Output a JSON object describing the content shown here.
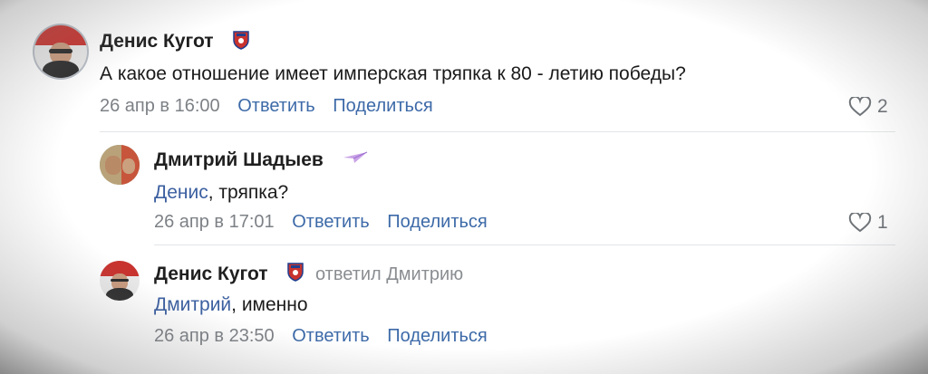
{
  "comments": [
    {
      "author": "Денис Кугот",
      "text": "А какое отношение имеет имперская тряпка к 80 - летию победы?",
      "date": "26 апр в 16:00",
      "reply_label": "Ответить",
      "share_label": "Поделиться",
      "likes": "2"
    },
    {
      "author": "Дмитрий Шадыев",
      "mention": "Денис",
      "text": ", тряпка?",
      "date": "26 апр в 17:01",
      "reply_label": "Ответить",
      "share_label": "Поделиться",
      "likes": "1"
    },
    {
      "author": "Денис Кугот",
      "reply_to": "ответил Дмитрию",
      "mention": "Дмитрий",
      "text": ", именно",
      "date": "26 апр в 23:50",
      "reply_label": "Ответить",
      "share_label": "Поделиться"
    }
  ],
  "icons": {
    "badge": "cska-badge-icon",
    "plane": "paper-plane-icon",
    "like": "heart-icon"
  },
  "colors": {
    "link": "#3d6aa8",
    "mention": "#3b5fa0",
    "badge_red": "#c8332f",
    "badge_blue": "#1f3f8f"
  }
}
